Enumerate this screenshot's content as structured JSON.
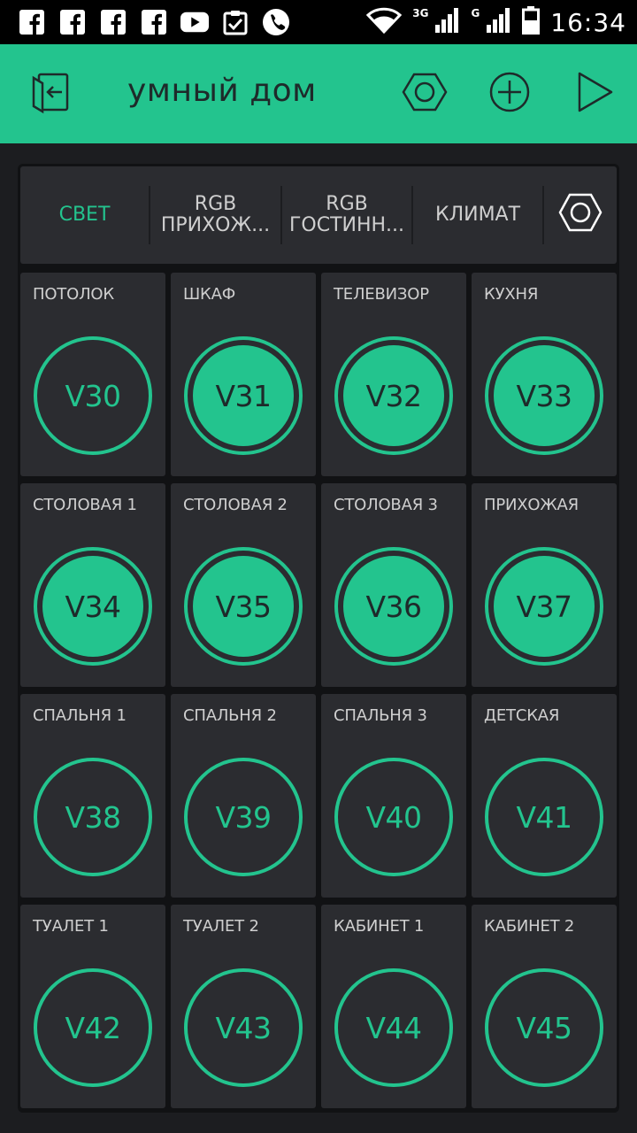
{
  "status_bar": {
    "time": "16:34",
    "net1": "3G",
    "net2": "G",
    "icons": [
      "facebook-icon",
      "facebook-icon",
      "facebook-icon",
      "facebook-icon",
      "youtube-icon",
      "clipboard-check-icon",
      "phone-icon",
      "wifi-icon",
      "signal-icon",
      "signal-icon",
      "battery-icon"
    ]
  },
  "app_bar": {
    "title": "умный дом"
  },
  "tabs": [
    {
      "label": "СВЕТ",
      "active": true
    },
    {
      "label": "RGB ПРИХОЖ...",
      "active": false
    },
    {
      "label": "RGB ГОСТИНН...",
      "active": false
    },
    {
      "label": "КЛИМАТ",
      "active": false
    }
  ],
  "tiles": [
    {
      "label": "ПОТОЛОК",
      "pin": "V30",
      "on": false
    },
    {
      "label": "ШКАФ",
      "pin": "V31",
      "on": true
    },
    {
      "label": "ТЕЛЕВИЗОР",
      "pin": "V32",
      "on": true
    },
    {
      "label": "КУХНЯ",
      "pin": "V33",
      "on": true
    },
    {
      "label": "СТОЛОВАЯ 1",
      "pin": "V34",
      "on": true
    },
    {
      "label": "СТОЛОВАЯ 2",
      "pin": "V35",
      "on": true
    },
    {
      "label": "СТОЛОВАЯ 3",
      "pin": "V36",
      "on": true
    },
    {
      "label": "ПРИХОЖАЯ",
      "pin": "V37",
      "on": true
    },
    {
      "label": "СПАЛЬНЯ 1",
      "pin": "V38",
      "on": false
    },
    {
      "label": "СПАЛЬНЯ 2",
      "pin": "V39",
      "on": false
    },
    {
      "label": "СПАЛЬНЯ 3",
      "pin": "V40",
      "on": false
    },
    {
      "label": "ДЕТСКАЯ",
      "pin": "V41",
      "on": false
    },
    {
      "label": "ТУАЛЕТ 1",
      "pin": "V42",
      "on": false
    },
    {
      "label": "ТУАЛЕТ 2",
      "pin": "V43",
      "on": false
    },
    {
      "label": "КАБИНЕТ 1",
      "pin": "V44",
      "on": false
    },
    {
      "label": "КАБИНЕТ 2",
      "pin": "V45",
      "on": false
    }
  ],
  "colors": {
    "accent": "#23c48e",
    "background": "#1c1d20",
    "tile": "#2b2c30",
    "text": "#cfcfcf"
  }
}
